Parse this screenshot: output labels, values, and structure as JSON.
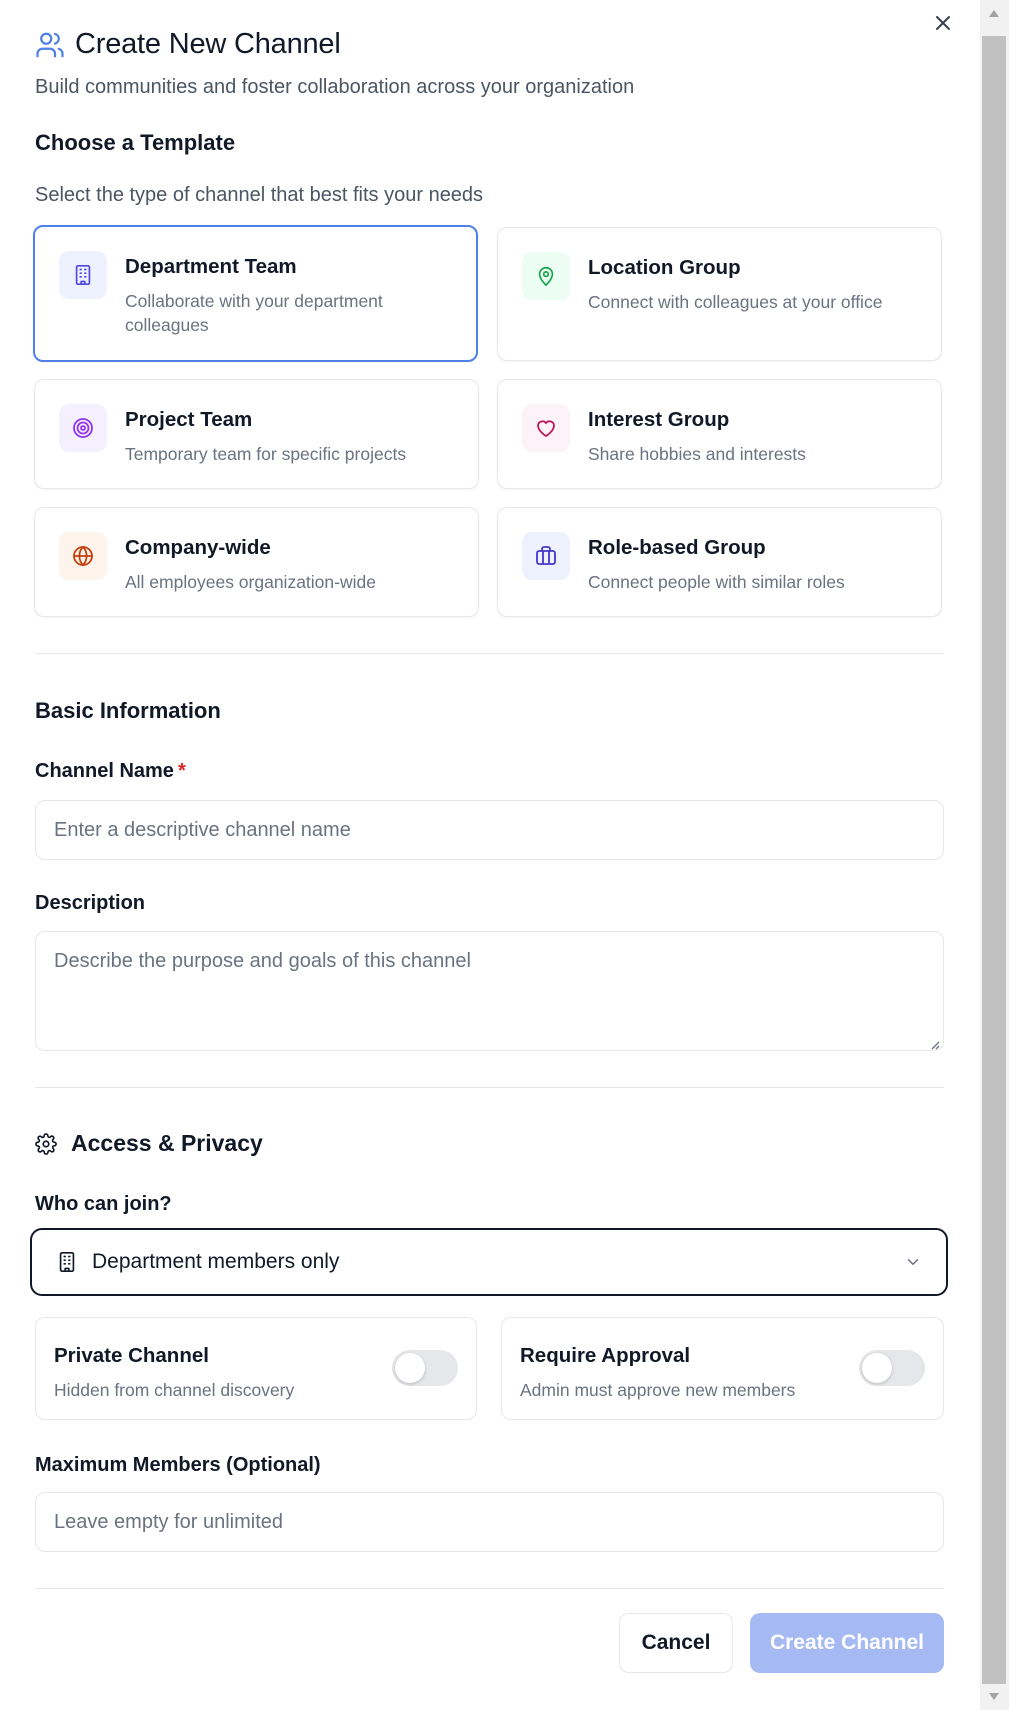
{
  "dialog": {
    "title": "Create New Channel",
    "subtitle": "Build communities and foster collaboration across your organization",
    "close_icon": "close-icon"
  },
  "templates_section": {
    "title": "Choose a Template",
    "description": "Select the type of channel that best fits your needs",
    "selected": "Department Team",
    "items": [
      {
        "name": "Department Team",
        "description": "Collaborate with your department colleagues",
        "icon": "building-icon",
        "icon_color": "#4f46e5",
        "icon_bg": "#eef2ff"
      },
      {
        "name": "Location Group",
        "description": "Connect with colleagues at your office",
        "icon": "map-pin-icon",
        "icon_color": "#16a34a",
        "icon_bg": "#ecfdf3"
      },
      {
        "name": "Project Team",
        "description": "Temporary team for specific projects",
        "icon": "target-icon",
        "icon_color": "#9333ea",
        "icon_bg": "#f5f0ff"
      },
      {
        "name": "Interest Group",
        "description": "Share hobbies and interests",
        "icon": "heart-icon",
        "icon_color": "#be185d",
        "icon_bg": "#fdf2f8"
      },
      {
        "name": "Company-wide",
        "description": "All employees organization-wide",
        "icon": "globe-icon",
        "icon_color": "#c2410c",
        "icon_bg": "#fff4ec"
      },
      {
        "name": "Role-based Group",
        "description": "Connect people with similar roles",
        "icon": "briefcase-icon",
        "icon_color": "#4338ca",
        "icon_bg": "#eef2ff"
      }
    ]
  },
  "basic_info": {
    "title": "Basic Information",
    "channel_name_label": "Channel Name",
    "required_mark": "*",
    "channel_name_value": "",
    "channel_name_placeholder": "Enter a descriptive channel name",
    "description_label": "Description",
    "description_value": "",
    "description_placeholder": "Describe the purpose and goals of this channel"
  },
  "access": {
    "title": "Access & Privacy",
    "icon": "gear-icon",
    "who_can_join_label": "Who can join?",
    "who_can_join_value": "Department members only",
    "who_can_join_icon": "building-icon",
    "private_channel": {
      "title": "Private Channel",
      "description": "Hidden from channel discovery",
      "enabled": false
    },
    "require_approval": {
      "title": "Require Approval",
      "description": "Admin must approve new members",
      "enabled": false
    },
    "max_members_label": "Maximum Members (Optional)",
    "max_members_value": "",
    "max_members_placeholder": "Leave empty for unlimited"
  },
  "footer": {
    "cancel_label": "Cancel",
    "create_label": "Create Channel"
  },
  "colors": {
    "accent": "#4f80e8",
    "create_button_disabled": "#a5b9f3",
    "required": "#dc2626"
  }
}
